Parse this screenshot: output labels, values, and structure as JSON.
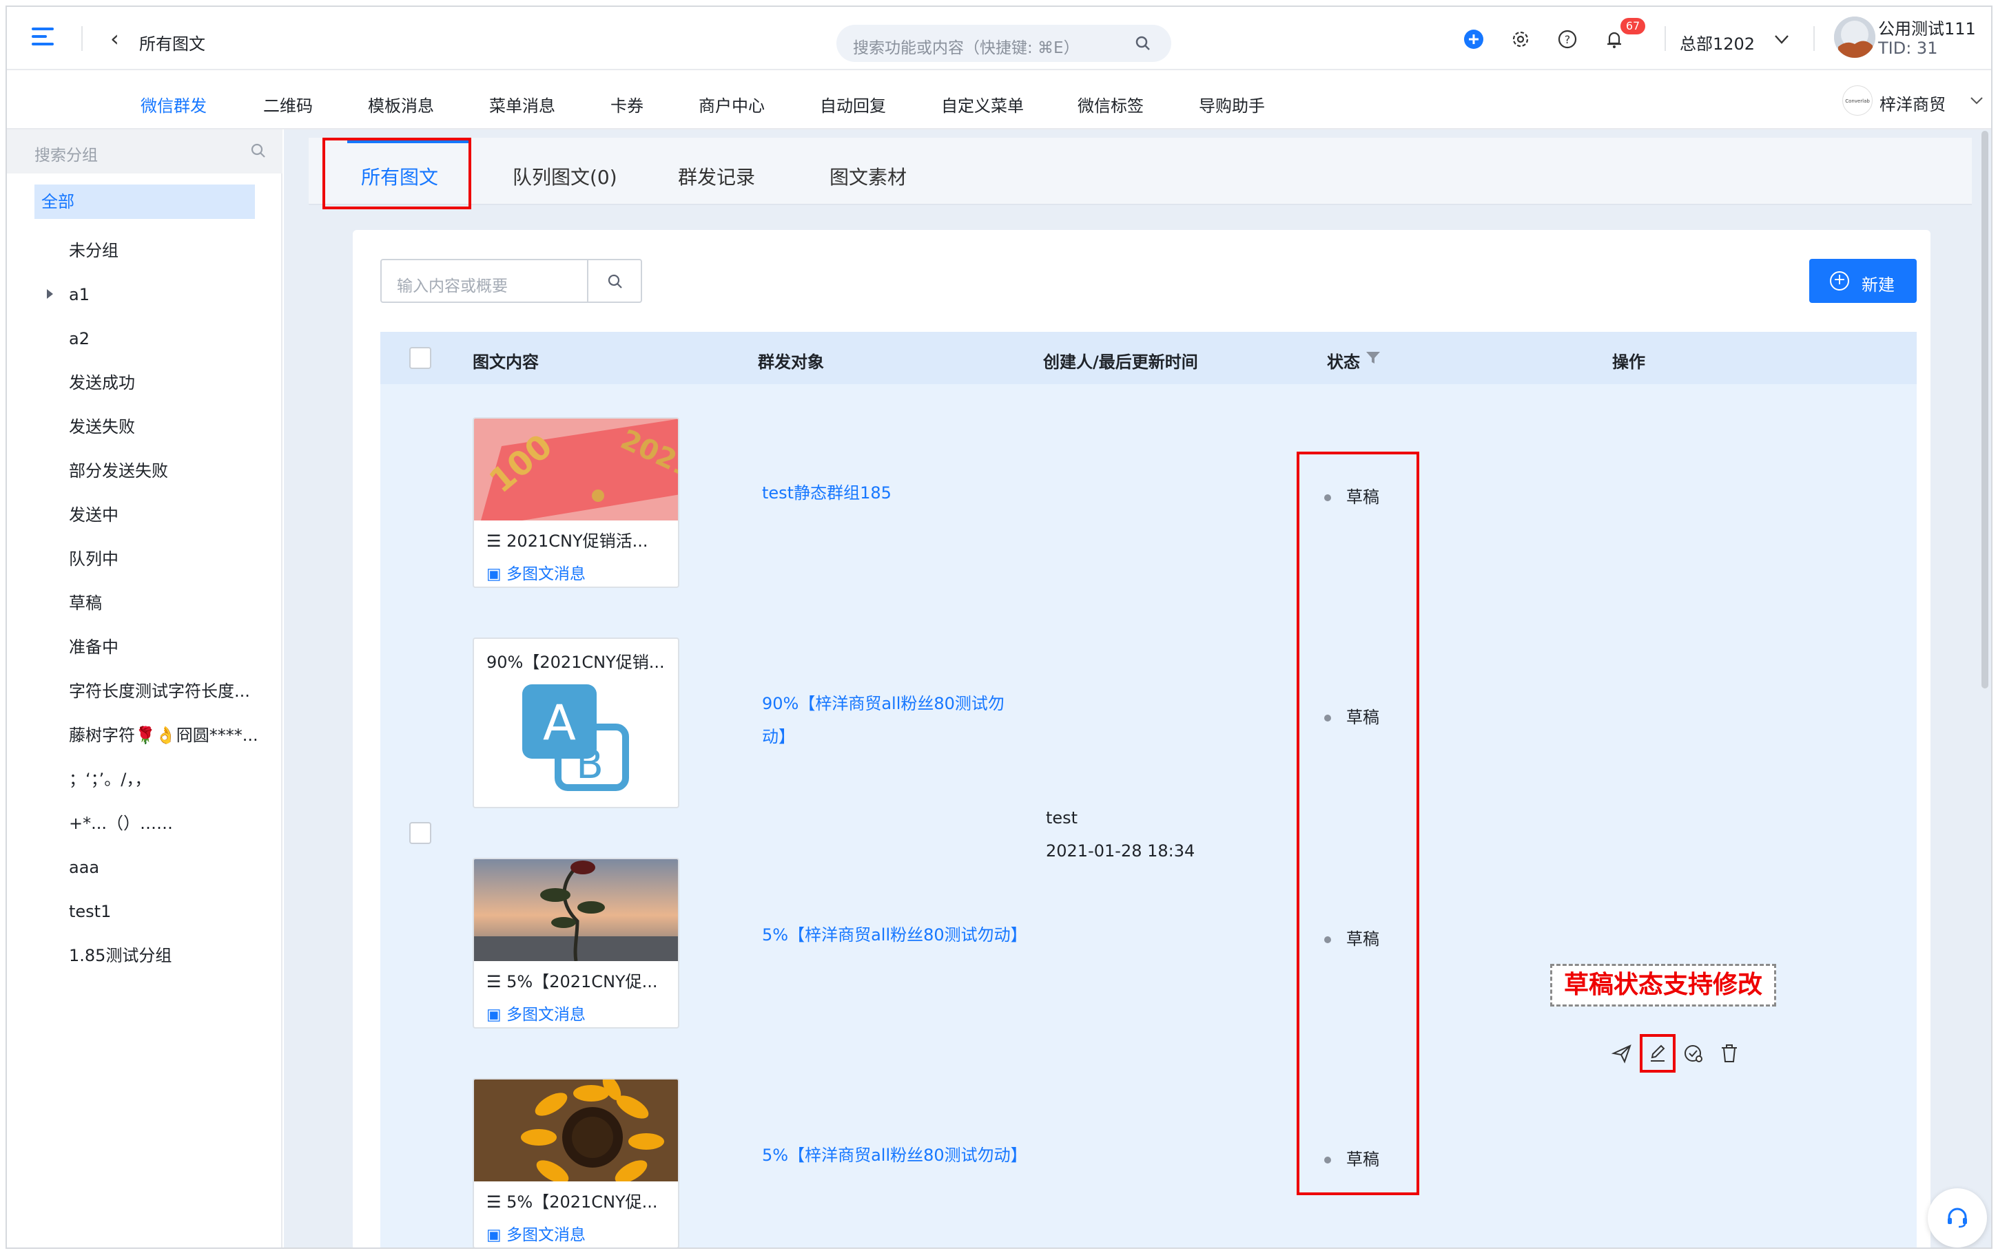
{
  "header": {
    "page_title": "所有图文",
    "search_placeholder": "搜索功能或内容（快捷键: ⌘E）",
    "notification_count": "67",
    "org": "总部1202",
    "account_name": "公用测试111",
    "account_tid": "TID: 31"
  },
  "nav": {
    "items": [
      "微信群发",
      "二维码",
      "模板消息",
      "菜单消息",
      "卡券",
      "商户中心",
      "自动回复",
      "自定义菜单",
      "微信标签",
      "导购助手"
    ],
    "active": "微信群发",
    "brand_name": "梓洋商贸"
  },
  "sidebar": {
    "search_placeholder": "搜索分组",
    "all_label": "全部",
    "groups": [
      "未分组",
      "a1",
      "a2",
      "发送成功",
      "发送失败",
      "部分发送失败",
      "发送中",
      "队列中",
      "草稿",
      "准备中",
      "字符长度测试字符长度...",
      "藤树字符🌹👌冏圆****...",
      "；‘；’。/，，",
      "+*...（）……",
      "aaa",
      "test1",
      "1.85测试分组"
    ]
  },
  "tabs": [
    "所有图文",
    "队列图文(0)",
    "群发记录",
    "图文素材"
  ],
  "toolbar": {
    "search_placeholder": "输入内容或概要",
    "new_label": "新建"
  },
  "table": {
    "columns": [
      "图文内容",
      "群发对象",
      "创建人/最后更新时间",
      "状态",
      "操作"
    ],
    "creator": "test",
    "updated": "2021-01-28 18:34",
    "rows": [
      {
        "title": "2021CNY促销活...",
        "type": "多图文消息",
        "target": "test静态群组185",
        "status": "草稿"
      },
      {
        "title": "90%【2021CNY促销...",
        "type": "",
        "target_line1": "90%【梓洋商贸all粉丝80测试勿",
        "target_line2": "动】",
        "status": "草稿"
      },
      {
        "title": "5%【2021CNY促...",
        "type": "多图文消息",
        "target": "5%【梓洋商贸all粉丝80测试勿动】",
        "status": "草稿"
      },
      {
        "title": "5%【2021CNY促...",
        "type": "多图文消息",
        "target": "5%【梓洋商贸all粉丝80测试勿动】",
        "status": "草稿"
      }
    ]
  },
  "annotation": "草稿状态支持修改",
  "colors": {
    "primary": "#1677ff",
    "highlight": "#e00000",
    "badge": "#f5433f"
  }
}
